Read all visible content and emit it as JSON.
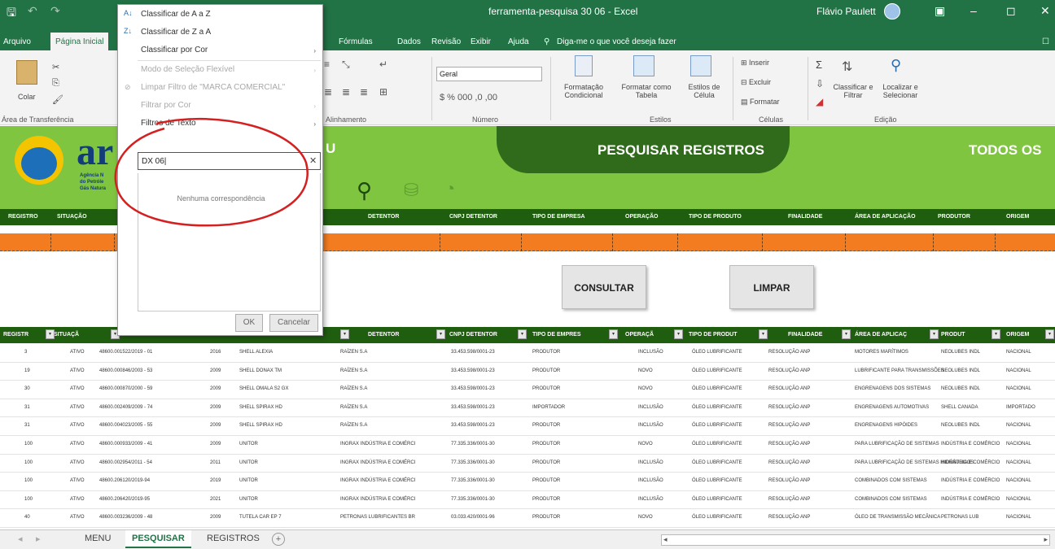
{
  "window": {
    "title": "ferramenta-pesquisa 30 06 - Excel",
    "user": "Flávio Paulett"
  },
  "ribbon_tabs": [
    "Arquivo",
    "Página Inicial",
    "Fórmulas",
    "Dados",
    "Revisão",
    "Exibir",
    "Ajuda",
    "Diga-me o que você deseja fazer"
  ],
  "ribbon": {
    "colar": "Colar",
    "clipboard_group": "Área de Transferência",
    "align_group": "Alinhamento",
    "number_format": "Geral",
    "number_group": "Número",
    "cond_format": "Formatação Condicional",
    "format_table": "Formatar como Tabela",
    "cell_styles": "Estilos de Célula",
    "styles_group": "Estilos",
    "insert": "Inserir",
    "delete": "Excluir",
    "format": "Formatar",
    "cells_group": "Células",
    "sort_filter": "Classificar e Filtrar",
    "find_select": "Localizar e Selecionar",
    "editing_group": "Edição"
  },
  "header": {
    "title": "PESQUISAR REGISTROS",
    "right_title": "TODOS OS",
    "left_fragment": "U",
    "logo_text": "ar",
    "agency_lines": [
      "Agência N",
      "do Petróle",
      "Gás Natura"
    ]
  },
  "columns_top": [
    "REGISTRO",
    "SITUAÇÃO",
    "DETENTOR",
    "CNPJ DETENTOR",
    "TIPO DE EMPRESA",
    "OPERAÇÃO",
    "TIPO DE PRODUTO",
    "FINALIDADE",
    "ÁREA DE APLICAÇÃO",
    "PRODUTOR",
    "ORIGEM"
  ],
  "columns_bottom": [
    "REGISTR",
    "SITUAÇÃ",
    "DETENTOR",
    "CNPJ DETENTOR",
    "TIPO DE EMPRES",
    "OPERAÇÃ",
    "TIPO DE PRODUT",
    "FINALIDADE",
    "ÁREA DE APLICAÇ",
    "PRODUT",
    "ORIGEM"
  ],
  "buttons": {
    "consultar": "CONSULTAR",
    "limpar": "LIMPAR"
  },
  "rows": [
    {
      "reg": "3",
      "sit": "ATIVO",
      "proc": "48600.001522/2019 - 01",
      "ano": "2016",
      "marca": "SHELL ALEXIA",
      "det": "RAÍZEN S.A",
      "cnpj": "33.453.598/0001-23",
      "tipo": "PRODUTOR",
      "op": "INCLUSÃO",
      "prod": "ÓLEO LUBRIFICANTE",
      "fin": "RESOLUÇÃO ANP",
      "area": "MOTORES MARÍTIMOS",
      "pr": "NEOLUBES INDL",
      "ori": "NACIONAL"
    },
    {
      "reg": "19",
      "sit": "ATIVO",
      "proc": "48600.000846/2003 - 53",
      "ano": "2009",
      "marca": "SHELL DONAX TM",
      "det": "RAÍZEN S.A",
      "cnpj": "33.453.598/0001-23",
      "tipo": "PRODUTOR",
      "op": "NOVO",
      "prod": "ÓLEO LUBRIFICANTE",
      "fin": "RESOLUÇÃO ANP",
      "area": "LUBRIFICANTE PARA TRANSMISSÕES",
      "pr": "NEOLUBES INDL",
      "ori": "NACIONAL"
    },
    {
      "reg": "30",
      "sit": "ATIVO",
      "proc": "48600.000870/2000 - 59",
      "ano": "2009",
      "marca": "SHELL OMALA S2 GX",
      "det": "RAÍZEN S.A",
      "cnpj": "33.453.598/0001-23",
      "tipo": "PRODUTOR",
      "op": "NOVO",
      "prod": "ÓLEO LUBRIFICANTE",
      "fin": "RESOLUÇÃO ANP",
      "area": "ENGRENAGENS DOS SISTEMAS",
      "pr": "NEOLUBES INDL",
      "ori": "NACIONAL"
    },
    {
      "reg": "31",
      "sit": "ATIVO",
      "proc": "48600.002409/2009 - 74",
      "ano": "2009",
      "marca": "SHELL SPIRAX HD",
      "det": "RAÍZEN S.A",
      "cnpj": "33.453.598/0001-23",
      "tipo": "IMPORTADOR",
      "op": "INCLUSÃO",
      "prod": "ÓLEO LUBRIFICANTE",
      "fin": "RESOLUÇÃO ANP",
      "area": "ENGRENAGENS AUTOMOTIVAS",
      "pr": "SHELL CANADA",
      "ori": "IMPORTADO"
    },
    {
      "reg": "31",
      "sit": "ATIVO",
      "proc": "48600.004023/2005 - 55",
      "ano": "2009",
      "marca": "SHELL SPIRAX HD",
      "det": "RAÍZEN S.A",
      "cnpj": "33.453.598/0001-23",
      "tipo": "PRODUTOR",
      "op": "INCLUSÃO",
      "prod": "ÓLEO LUBRIFICANTE",
      "fin": "RESOLUÇÃO ANP",
      "area": "ENGRENAGENS HIPÓIDES",
      "pr": "NEOLUBES INDL",
      "ori": "NACIONAL"
    },
    {
      "reg": "100",
      "sit": "ATIVO",
      "proc": "48600.000933/2009 - 41",
      "ano": "2009",
      "marca": "UNITOR",
      "det": "INGRAX INDÚSTRIA E COMÉRCI",
      "cnpj": "77.335.336/0001-30",
      "tipo": "PRODUTOR",
      "op": "NOVO",
      "prod": "ÓLEO LUBRIFICANTE",
      "fin": "RESOLUÇÃO ANP",
      "area": "PARA LUBRIFICAÇÃO DE SISTEMAS",
      "pr": "INDÚSTRIA E COMÉRCIO",
      "ori": "NACIONAL"
    },
    {
      "reg": "100",
      "sit": "ATIVO",
      "proc": "48600.002954/2011 - 54",
      "ano": "2011",
      "marca": "UNITOR",
      "det": "INGRAX INDÚSTRIA E COMÉRCI",
      "cnpj": "77.335.336/0001-30",
      "tipo": "PRODUTOR",
      "op": "INCLUSÃO",
      "prod": "ÓLEO LUBRIFICANTE",
      "fin": "RESOLUÇÃO ANP",
      "area": "PARA LUBRIFICAÇÃO DE SISTEMAS HIDRÁULICOS",
      "pr": "INDÚSTRIA E COMÉRCIO",
      "ori": "NACIONAL"
    },
    {
      "reg": "100",
      "sit": "ATIVO",
      "proc": "48600.206120/2019-94",
      "ano": "2019",
      "marca": "UNITOR",
      "det": "INGRAX INDÚSTRIA E COMÉRCI",
      "cnpj": "77.335.336/0001-30",
      "tipo": "PRODUTOR",
      "op": "INCLUSÃO",
      "prod": "ÓLEO LUBRIFICANTE",
      "fin": "RESOLUÇÃO ANP",
      "area": "COMBINADOS COM SISTEMAS",
      "pr": "INDÚSTRIA E COMÉRCIO",
      "ori": "NACIONAL"
    },
    {
      "reg": "100",
      "sit": "ATIVO",
      "proc": "48600.206420/2019-95",
      "ano": "2021",
      "marca": "UNITOR",
      "det": "INGRAX INDÚSTRIA E COMÉRCI",
      "cnpj": "77.335.336/0001-30",
      "tipo": "PRODUTOR",
      "op": "INCLUSÃO",
      "prod": "ÓLEO LUBRIFICANTE",
      "fin": "RESOLUÇÃO ANP",
      "area": "COMBINADOS COM SISTEMAS",
      "pr": "INDÚSTRIA E COMÉRCIO",
      "ori": "NACIONAL"
    },
    {
      "reg": "40",
      "sit": "ATIVO",
      "proc": "48600.003236/2009 - 48",
      "ano": "2009",
      "marca": "TUTELA CAR EP 7",
      "det": "PETRONAS LUBRIFICANTES BR",
      "cnpj": "03.033.420/0001-96",
      "tipo": "PRODUTOR",
      "op": "NOVO",
      "prod": "ÓLEO LUBRIFICANTE",
      "fin": "RESOLUÇÃO ANP",
      "area": "ÓLEO DE TRANSMISSÃO MECÂNICA",
      "pr": "PETRONAS LUB",
      "ori": "NACIONAL"
    }
  ],
  "filter_menu": {
    "sort_az": "Classificar de A a Z",
    "sort_za": "Classificar de Z a A",
    "sort_color": "Classificar por Cor",
    "sheet_view": "Modo de Seleção Flexível",
    "clear_filter": "Limpar Filtro de \"MARCA COMERCIAL\"",
    "filter_color": "Filtrar por Cor",
    "text_filters": "Filtros de Texto",
    "search_value": "DX 06|",
    "no_match": "Nenhuma correspondência",
    "ok": "OK",
    "cancel": "Cancelar"
  },
  "sheets": [
    "MENU",
    "PESQUISAR",
    "REGISTROS"
  ],
  "colors": {
    "excel_green": "#217346",
    "band_green": "#7fc540",
    "dark_green": "#2f6b1a",
    "orange": "#f47c20",
    "annotation_red": "#d42020"
  }
}
